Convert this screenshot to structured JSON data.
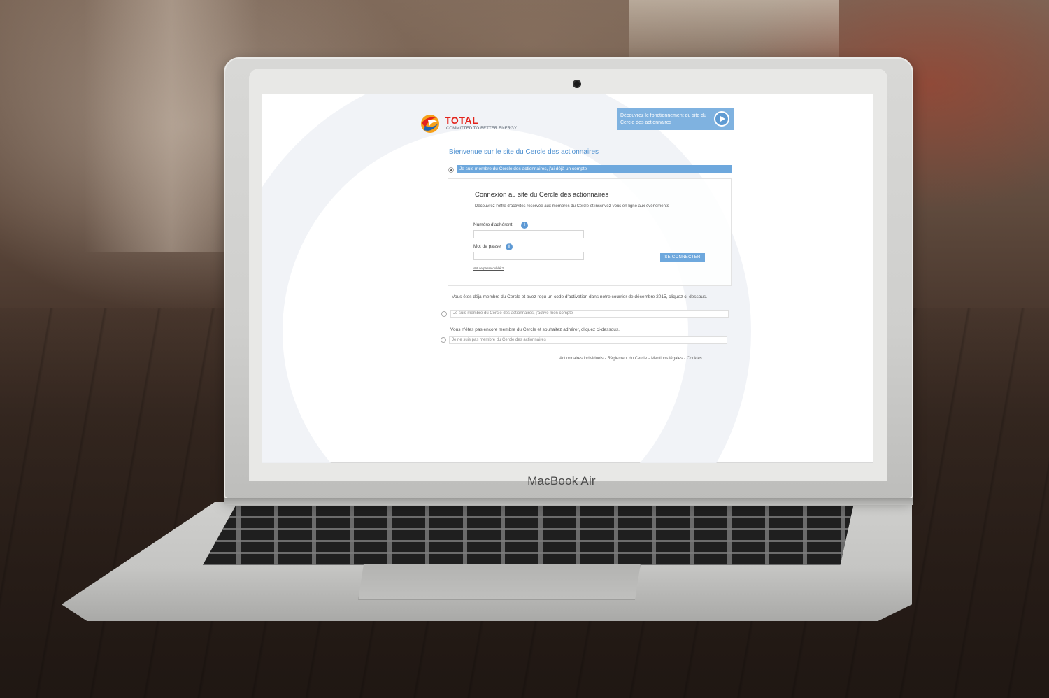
{
  "laptop": {
    "brand_label": "MacBook Air"
  },
  "site": {
    "logo": {
      "word": "TOTAL",
      "tagline": "COMMITTED TO BETTER ENERGY"
    },
    "video_banner": {
      "text": "Découvrez le fonctionnement du site du Cercle des actionnaires"
    },
    "title": "Bienvenue sur le site du Cercle des actionnaires",
    "options": {
      "member": {
        "label": "Je suis membre du Cercle des actionnaires, j'ai déjà un compte",
        "checked": true
      },
      "activate": {
        "intro": "Vous êtes déjà membre du Cercle et avez reçu un code d'activation dans notre courrier de décembre 2015, cliquez ci-dessous.",
        "label": "Je suis membre du Cercle des actionnaires, j'active mon compte",
        "checked": false
      },
      "not_member": {
        "intro": "Vous n'êtes pas encore membre du Cercle et souhaitez adhérer, cliquez ci-dessous.",
        "label": "Je ne suis pas membre du Cercle des actionnaires",
        "checked": false
      }
    },
    "login": {
      "title": "Connexion au site du Cercle des actionnaires",
      "description": "Découvrez l'offre d'activités réservée aux membres du Cercle et inscrivez-vous en ligne aux événements",
      "member_number_label": "Numéro d'adhérent",
      "member_number_value": "",
      "password_label": "Mot de passe",
      "password_value": "",
      "info_glyph": "i",
      "connect_label": "SE CONNECTER",
      "forgot_label": "Mot de passe oublié ?"
    },
    "footer": {
      "links": [
        "Actionnaires individuels",
        "Règlement du Cercle",
        "Mentions légales",
        "Cookies"
      ],
      "separator": "-"
    }
  },
  "colors": {
    "accent": "#6ea8dd",
    "brand_red": "#e3231b",
    "title_blue": "#4c8fd0"
  }
}
